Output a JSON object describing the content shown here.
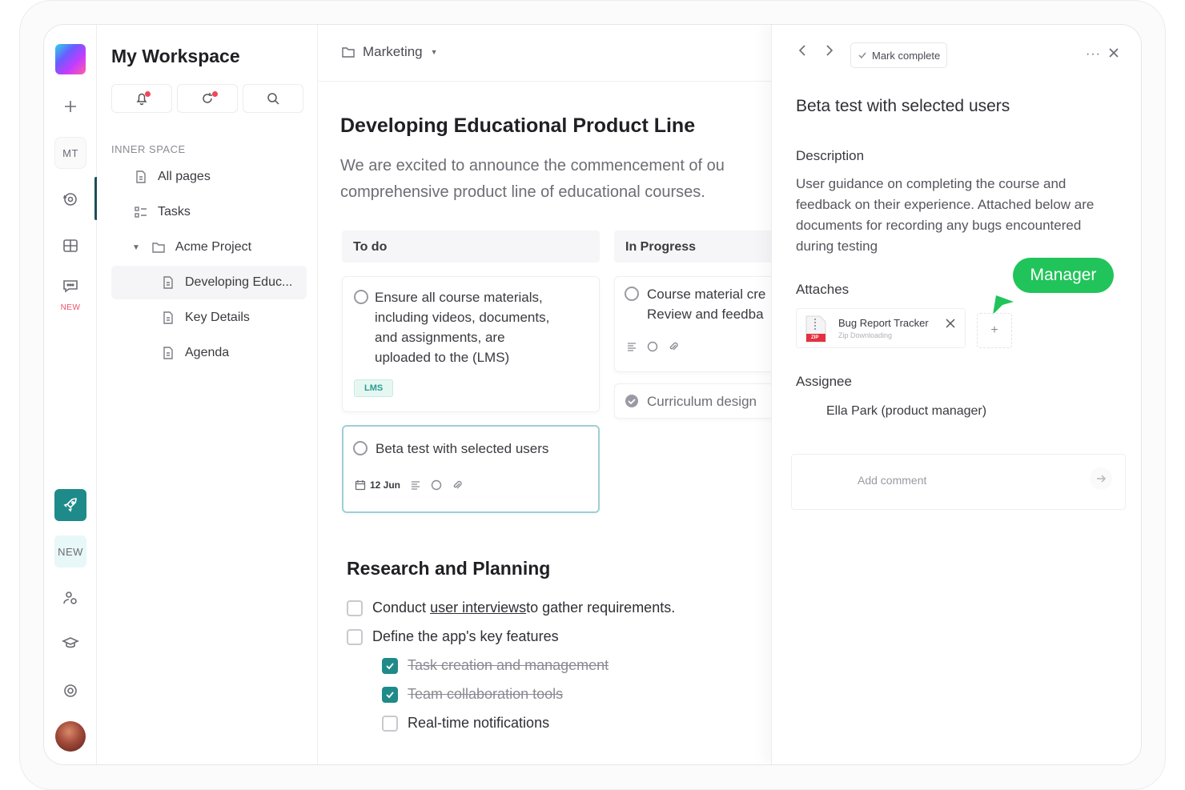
{
  "rail": {
    "user_initials": "MT",
    "new_badge_red": "NEW",
    "new_badge_teal": "NEW"
  },
  "sidebar": {
    "workspace_title": "My Workspace",
    "section_label": "INNER SPACE",
    "items": [
      {
        "label": "All pages",
        "icon": "page-icon"
      },
      {
        "label": "Tasks",
        "icon": "tasks-icon"
      },
      {
        "label": "Acme Project",
        "icon": "folder-icon"
      },
      {
        "label": "Developing Educ...",
        "icon": "page-icon"
      },
      {
        "label": "Key Details",
        "icon": "page-icon"
      },
      {
        "label": "Agenda",
        "icon": "page-icon"
      }
    ]
  },
  "main": {
    "breadcrumb": "Marketing",
    "title": "Developing Educational Product Line",
    "description_line1": "We are excited to announce the commencement of ou",
    "description_line2": "comprehensive product line of educational courses.",
    "columns": [
      {
        "label": "To do"
      },
      {
        "label": "In Progress"
      }
    ],
    "todo_cards": [
      {
        "lines": [
          "Ensure all course materials,",
          "including videos, documents,",
          "and assignments, are",
          "uploaded to the (LMS)"
        ],
        "tag": "LMS"
      },
      {
        "lines": [
          "Beta test with selected users"
        ],
        "date": "12 Jun"
      }
    ],
    "progress_cards": [
      {
        "lines": [
          "Course material cre",
          "Review and feedba"
        ]
      },
      {
        "lines": [
          "Curriculum design"
        ]
      }
    ],
    "research": {
      "title": "Research and Planning",
      "items": [
        {
          "pre": "Conduct ",
          "link": "user interviews",
          "post": " to gather requirements.",
          "checked": false
        },
        {
          "text": "Define the app's key features",
          "checked": false
        },
        {
          "text": "Task creation and management",
          "checked": true
        },
        {
          "text": "Team collaboration tools",
          "checked": true
        },
        {
          "text": "Real-time notifications",
          "checked": false
        }
      ]
    }
  },
  "detail": {
    "mark_complete": "Mark complete",
    "title": "Beta test with selected users",
    "description_label": "Description",
    "description": "User guidance on completing the course and feedback on their experience. Attached below are documents for recording any bugs encountered during testing",
    "manager_badge": "Manager",
    "attaches_label": "Attaches",
    "file_name": "Bug Report Tracker",
    "file_status": "Zip Downloading",
    "file_type": "ZIP",
    "assignee_label": "Assignee",
    "assignee": "Ella Park (product manager)",
    "comment_placeholder": "Add comment"
  },
  "colors": {
    "accent_teal": "#1f8a8a",
    "manager_green": "#21c45a",
    "new_red": "#f0516b"
  }
}
